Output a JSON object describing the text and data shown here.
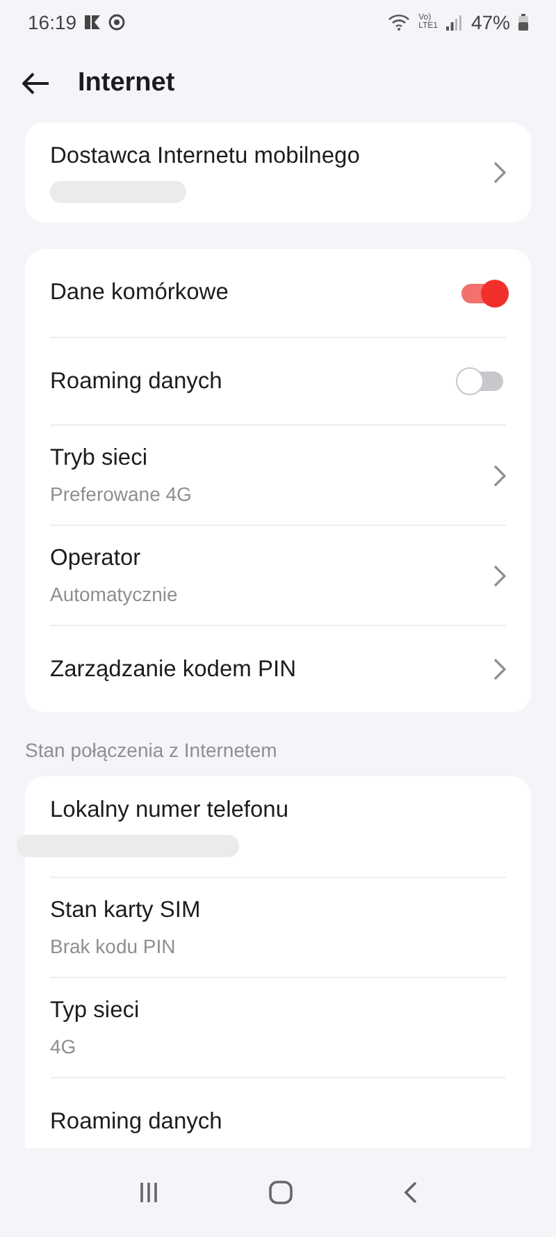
{
  "status_bar": {
    "time": "16:19",
    "network_top": "Vo)",
    "network_bottom": "LTE1",
    "battery": "47%"
  },
  "header": {
    "title": "Internet"
  },
  "groups": [
    {
      "rows": [
        {
          "kind": "link",
          "title": "Dostawca Internetu mobilnego",
          "redacted": true
        }
      ]
    },
    {
      "rows": [
        {
          "kind": "toggle",
          "title": "Dane komórkowe",
          "on": true
        },
        {
          "kind": "toggle",
          "title": "Roaming danych",
          "on": false
        },
        {
          "kind": "link",
          "title": "Tryb sieci",
          "subtitle": "Preferowane 4G"
        },
        {
          "kind": "link",
          "title": "Operator",
          "subtitle": "Automatycznie"
        },
        {
          "kind": "link",
          "title": "Zarządzanie kodem PIN"
        }
      ]
    },
    {
      "section_title": "Stan połączenia z Internetem",
      "rows": [
        {
          "kind": "info",
          "title": "Lokalny numer telefonu",
          "redacted": true
        },
        {
          "kind": "info",
          "title": "Stan karty SIM",
          "subtitle": "Brak kodu PIN"
        },
        {
          "kind": "info",
          "title": "Typ sieci",
          "subtitle": "4G"
        },
        {
          "kind": "info",
          "title": "Roaming danych"
        }
      ]
    }
  ]
}
